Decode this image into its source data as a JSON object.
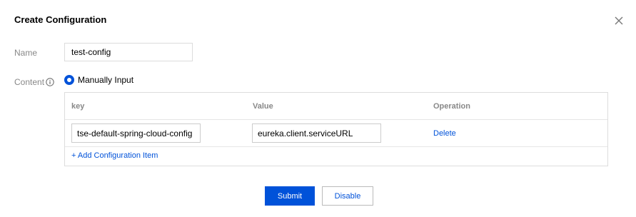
{
  "dialog": {
    "title": "Create Configuration",
    "close_icon": "close-icon"
  },
  "form": {
    "name_label": "Name",
    "name_value": "test-config",
    "content_label": "Content",
    "info_icon": "info-circle-icon",
    "content_mode_option": "Manually Input",
    "content_mode_selected": true
  },
  "table": {
    "columns": [
      "key",
      "Value",
      "Operation"
    ],
    "rows": [
      {
        "key": "tse-default-spring-cloud-config",
        "value": "eureka.client.serviceURL",
        "operation": "Delete"
      }
    ],
    "add_item_label": "+ Add Configuration Item"
  },
  "footer": {
    "submit_label": "Submit",
    "disable_label": "Disable"
  },
  "colors": {
    "primary": "#0052d9",
    "label_gray": "#888888",
    "border": "#dddddd"
  }
}
